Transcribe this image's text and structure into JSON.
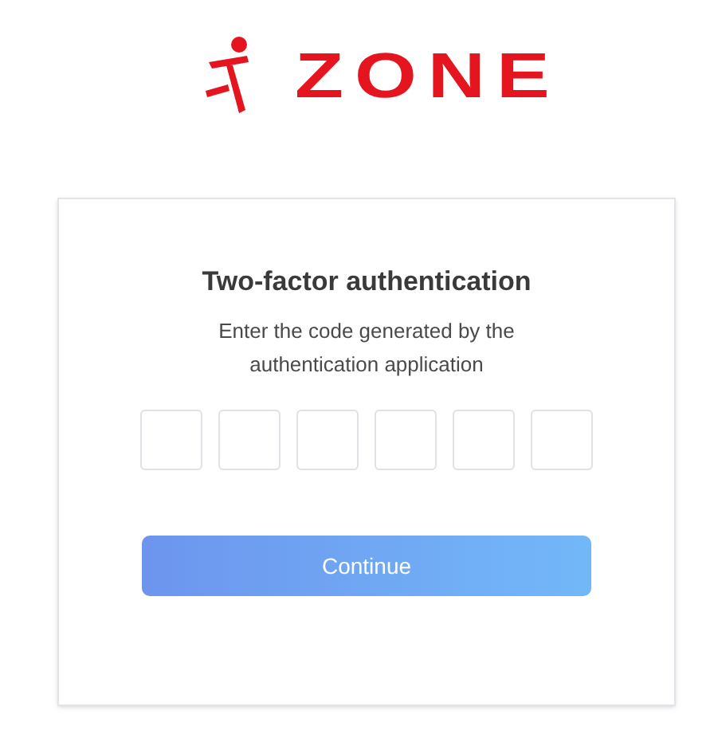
{
  "logo": {
    "text": "ZONE"
  },
  "card": {
    "title": "Two-factor authentication",
    "description": "Enter the code generated by the authentication application",
    "code_fields": [
      {
        "kind": "digit"
      },
      {
        "kind": "digit"
      },
      {
        "kind": "digit"
      },
      {
        "kind": "digit"
      },
      {
        "kind": "digit"
      },
      {
        "kind": "digit"
      }
    ],
    "button": "Continue"
  }
}
